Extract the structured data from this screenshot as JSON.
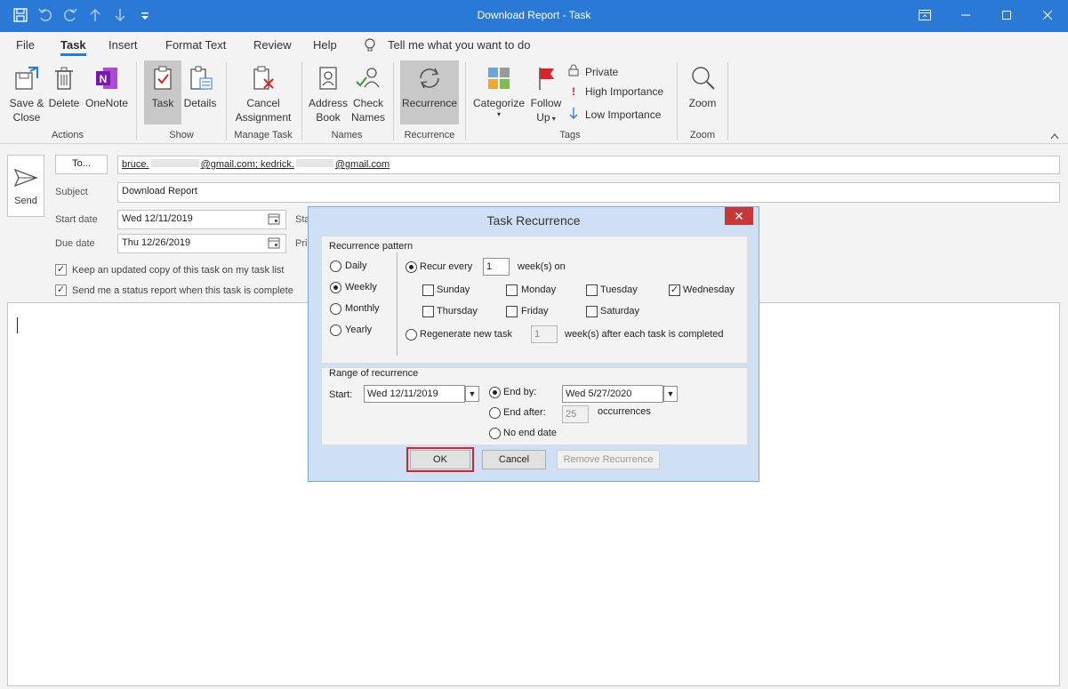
{
  "window": {
    "title": "Download Report  -  Task"
  },
  "menu": {
    "tabs": [
      "File",
      "Task",
      "Insert",
      "Format Text",
      "Review",
      "Help"
    ],
    "active_tab": "Task",
    "tell_me": "Tell me what you want to do"
  },
  "ribbon": {
    "save_close": [
      "Save &",
      "Close"
    ],
    "delete": "Delete",
    "onenote": "OneNote",
    "task": "Task",
    "details": "Details",
    "cancel_assignment": [
      "Cancel",
      "Assignment"
    ],
    "address_book": [
      "Address",
      "Book"
    ],
    "check_names": [
      "Check",
      "Names"
    ],
    "recurrence": "Recurrence",
    "categorize": "Categorize",
    "follow_up": [
      "Follow",
      "Up"
    ],
    "private": "Private",
    "high_importance": "High Importance",
    "low_importance": "Low Importance",
    "zoom": "Zoom",
    "groups": {
      "actions": "Actions",
      "show": "Show",
      "manage_task": "Manage Task",
      "names": "Names",
      "recurrence": "Recurrence",
      "tags": "Tags",
      "zoom": "Zoom"
    }
  },
  "form": {
    "send_label": "Send",
    "to_button": "To...",
    "to_value_a": "bruce.",
    "to_value_b": "@gmail.com; kedrick.",
    "to_value_c": "@gmail.com",
    "subject_label": "Subject",
    "subject_value": "Download Report",
    "start_label": "Start date",
    "start_value": "Wed 12/11/2019",
    "due_label": "Due date",
    "due_value": "Thu 12/26/2019",
    "status_label_partial": "Sta",
    "priority_label_partial": "Pri",
    "keep_copy": "Keep an updated copy of this task on my task list",
    "status_report": "Send me a status report when this task is complete"
  },
  "dialog": {
    "title": "Task Recurrence",
    "pattern_title": "Recurrence pattern",
    "daily": "Daily",
    "weekly": "Weekly",
    "monthly": "Monthly",
    "yearly": "Yearly",
    "recur_every": "Recur every",
    "recur_value": "1",
    "weeks_on": "week(s) on",
    "days": [
      "Sunday",
      "Monday",
      "Tuesday",
      "Wednesday",
      "Thursday",
      "Friday",
      "Saturday"
    ],
    "regenerate": "Regenerate new task",
    "regen_value": "1",
    "regen_after": "week(s) after each task is completed",
    "range_title": "Range of recurrence",
    "start_label": "Start:",
    "start_value": "Wed 12/11/2019",
    "end_by": "End by:",
    "end_by_value": "Wed 5/27/2020",
    "end_after": "End after:",
    "end_after_value": "25",
    "occurrences": "occurrences",
    "no_end": "No end date",
    "ok": "OK",
    "cancel": "Cancel",
    "remove": "Remove Recurrence"
  },
  "colors": {
    "accent": "#2b79d7",
    "highlight_red": "#d8232a",
    "close_red": "#c83737"
  }
}
